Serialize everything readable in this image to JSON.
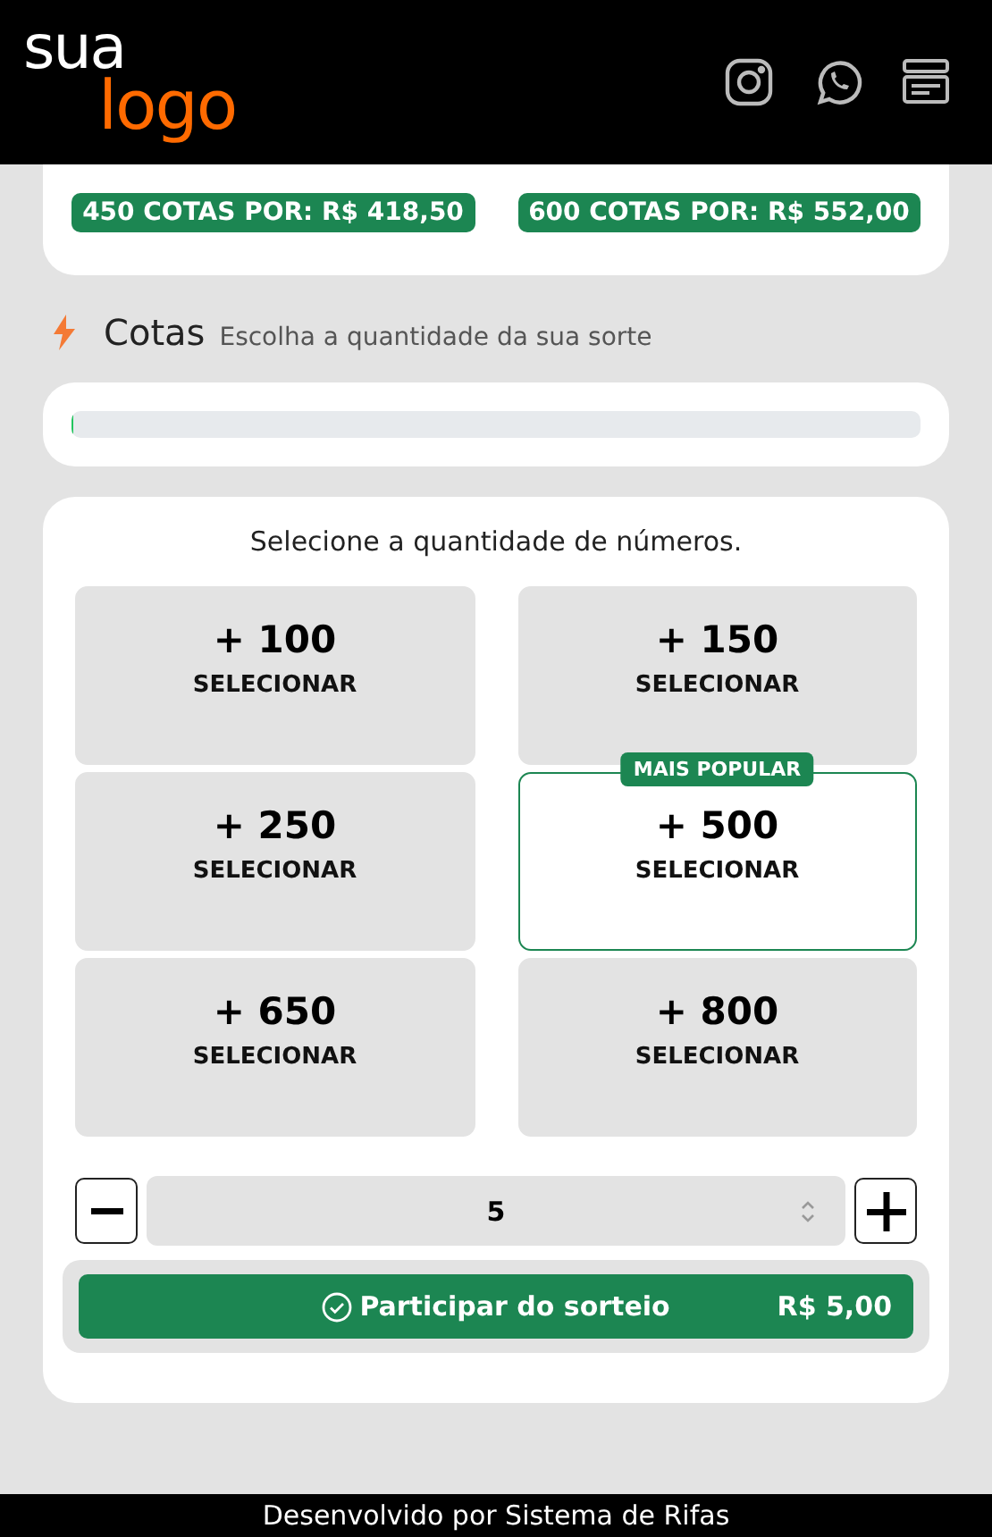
{
  "header": {
    "logo_top": "sua",
    "logo_bottom": "logo"
  },
  "promo_badges": [
    {
      "label": "450 COTAS POR: R$ 418,50"
    },
    {
      "label": "600 COTAS POR: R$ 552,00"
    }
  ],
  "section": {
    "title": "Cotas",
    "subtitle": "Escolha a quantidade da sua sorte"
  },
  "progress": {
    "level": 0.003
  },
  "selector": {
    "heading": "Selecione a quantidade de números.",
    "options": [
      {
        "amount": "+ 100",
        "action": "SELECIONAR",
        "popular": false
      },
      {
        "amount": "+ 150",
        "action": "SELECIONAR",
        "popular": false
      },
      {
        "amount": "+ 250",
        "action": "SELECIONAR",
        "popular": false
      },
      {
        "amount": "+ 500",
        "action": "SELECIONAR",
        "popular": true
      },
      {
        "amount": "+ 650",
        "action": "SELECIONAR",
        "popular": false
      },
      {
        "amount": "+ 800",
        "action": "SELECIONAR",
        "popular": false
      }
    ],
    "popular_badge": "MAIS POPULAR",
    "quantity": "5",
    "submit": {
      "label": "Participar do sorteio",
      "price": "R$ 5,00"
    }
  },
  "footer": "Desenvolvido por Sistema de Rifas"
}
